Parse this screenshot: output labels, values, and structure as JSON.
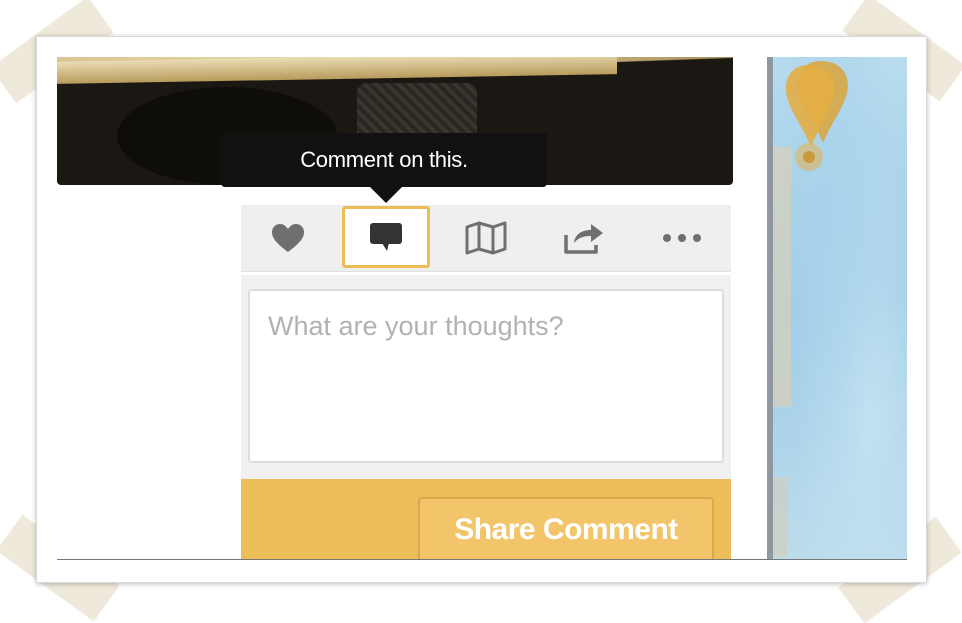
{
  "tooltip": {
    "text": "Comment on this."
  },
  "actions": [
    {
      "name": "like",
      "icon": "heart-icon"
    },
    {
      "name": "comment",
      "icon": "comment-icon",
      "active": true
    },
    {
      "name": "map",
      "icon": "map-icon"
    },
    {
      "name": "share",
      "icon": "share-icon"
    },
    {
      "name": "more",
      "icon": "more-icon"
    }
  ],
  "comment": {
    "placeholder": "What are your thoughts?",
    "submit_label": "Share Comment"
  },
  "map_panel": {
    "icon": "map-pin-icon"
  },
  "colors": {
    "accent": "#edbd59",
    "tooltip_bg": "#111111",
    "icon": "#6f6f6f"
  }
}
